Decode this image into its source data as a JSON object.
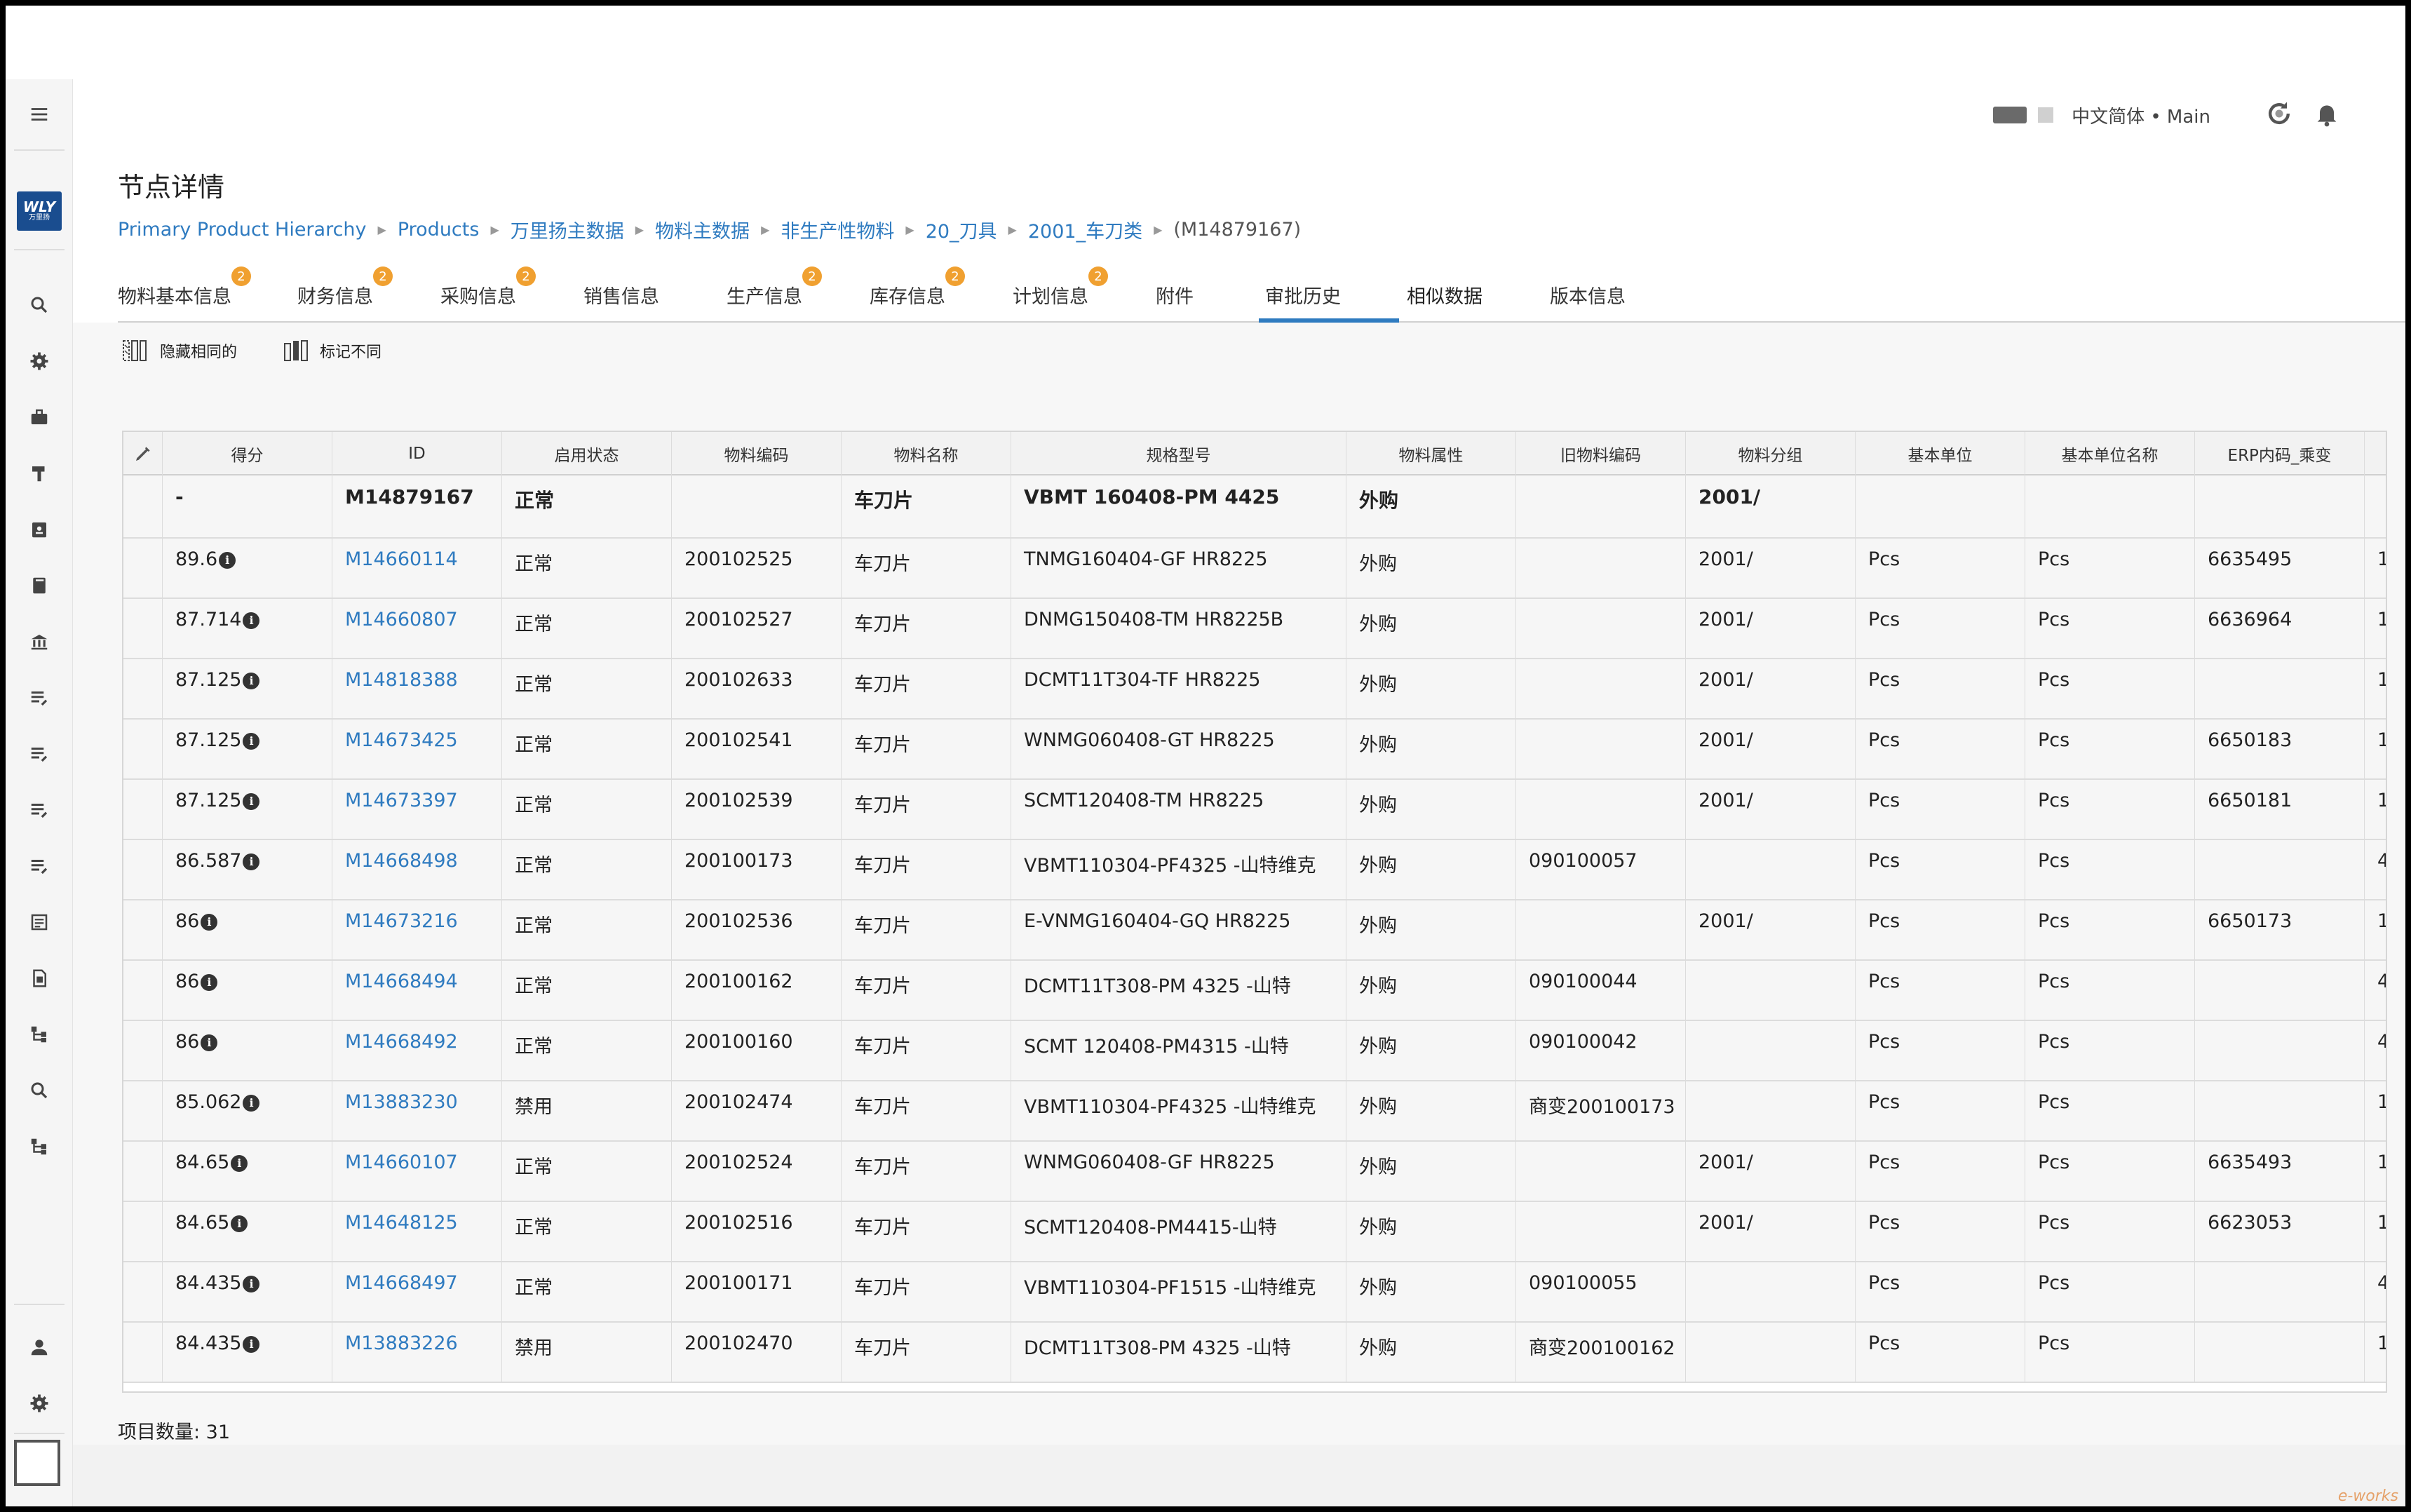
{
  "header": {
    "language": "中文简体 • Main",
    "icons": [
      "refresh-icon",
      "bell-icon"
    ]
  },
  "nav": {
    "logo_text": "WLY",
    "logo_sub": "万里扬",
    "icons": [
      "menu-icon",
      "search-icon",
      "gear-icon",
      "briefcase-icon",
      "tool-icon",
      "clipboard-icon",
      "book-icon",
      "bank-icon",
      "list-edit-icon",
      "list-edit-icon",
      "list-edit-icon",
      "list-edit-icon",
      "document-icon",
      "file-icon",
      "hierarchy-icon",
      "search-icon",
      "hierarchy-icon",
      "user-icon",
      "gear-icon"
    ]
  },
  "page": {
    "title": "节点详情",
    "breadcrumb": [
      "Primary Product Hierarchy",
      "Products",
      "万里扬主数据",
      "物料主数据",
      "非生产性物料",
      "20_刀具",
      "2001_车刀类"
    ],
    "current": "(M14879167)"
  },
  "tabs": [
    {
      "label": "物料基本信息",
      "badge": "2"
    },
    {
      "label": "财务信息",
      "badge": "2"
    },
    {
      "label": "采购信息",
      "badge": "2"
    },
    {
      "label": "销售信息",
      "badge": ""
    },
    {
      "label": "生产信息",
      "badge": "2"
    },
    {
      "label": "库存信息",
      "badge": "2"
    },
    {
      "label": "计划信息",
      "badge": "2"
    },
    {
      "label": "附件",
      "badge": ""
    },
    {
      "label": "审批历史",
      "badge": ""
    },
    {
      "label": "相似数据",
      "badge": "",
      "active": true
    },
    {
      "label": "版本信息",
      "badge": ""
    }
  ],
  "toolbar": {
    "hide_same": "隐藏相同的",
    "mark_diff": "标记不同"
  },
  "table": {
    "columns": [
      "得分",
      "ID",
      "启用状态",
      "物料编码",
      "物料名称",
      "规格型号",
      "物料属性",
      "旧物料编码",
      "物料分组",
      "基本单位",
      "基本单位名称",
      "ERP内码_乘变"
    ],
    "reference": [
      "-",
      "M14879167",
      "正常",
      "",
      "车刀片",
      "VBMT 160408-PM 4425",
      "外购",
      "",
      "2001/",
      "",
      "",
      ""
    ],
    "rows": [
      [
        "89.6",
        "M14660114",
        "正常",
        "200102525",
        "车刀片",
        "TNMG160404-GF HR8225",
        "外购",
        "",
        "2001/",
        "Pcs",
        "Pcs",
        "6635495",
        "1"
      ],
      [
        "87.714",
        "M14660807",
        "正常",
        "200102527",
        "车刀片",
        "DNMG150408-TM HR8225B",
        "外购",
        "",
        "2001/",
        "Pcs",
        "Pcs",
        "6636964",
        "1"
      ],
      [
        "87.125",
        "M14818388",
        "正常",
        "200102633",
        "车刀片",
        "DCMT11T304-TF HR8225",
        "外购",
        "",
        "2001/",
        "Pcs",
        "Pcs",
        "",
        "1"
      ],
      [
        "87.125",
        "M14673425",
        "正常",
        "200102541",
        "车刀片",
        "WNMG060408-GT HR8225",
        "外购",
        "",
        "2001/",
        "Pcs",
        "Pcs",
        "6650183",
        "1"
      ],
      [
        "87.125",
        "M14673397",
        "正常",
        "200102539",
        "车刀片",
        "SCMT120408-TM HR8225",
        "外购",
        "",
        "2001/",
        "Pcs",
        "Pcs",
        "6650181",
        "1"
      ],
      [
        "86.587",
        "M14668498",
        "正常",
        "200100173",
        "车刀片",
        "VBMT110304-PF4325 -山特维克",
        "外购",
        "090100057",
        "",
        "Pcs",
        "Pcs",
        "",
        "4"
      ],
      [
        "86",
        "M14673216",
        "正常",
        "200102536",
        "车刀片",
        "E-VNMG160404-GQ HR8225",
        "外购",
        "",
        "2001/",
        "Pcs",
        "Pcs",
        "6650173",
        "1"
      ],
      [
        "86",
        "M14668494",
        "正常",
        "200100162",
        "车刀片",
        "DCMT11T308-PM 4325 -山特",
        "外购",
        "090100044",
        "",
        "Pcs",
        "Pcs",
        "",
        "4"
      ],
      [
        "86",
        "M14668492",
        "正常",
        "200100160",
        "车刀片",
        "SCMT 120408-PM4315 -山特",
        "外购",
        "090100042",
        "",
        "Pcs",
        "Pcs",
        "",
        "4"
      ],
      [
        "85.062",
        "M13883230",
        "禁用",
        "200102474",
        "车刀片",
        "VBMT110304-PF4325 -山特维克",
        "外购",
        "商变200100173",
        "",
        "Pcs",
        "Pcs",
        "",
        "1"
      ],
      [
        "84.65",
        "M14660107",
        "正常",
        "200102524",
        "车刀片",
        "WNMG060408-GF HR8225",
        "外购",
        "",
        "2001/",
        "Pcs",
        "Pcs",
        "6635493",
        "1"
      ],
      [
        "84.65",
        "M14648125",
        "正常",
        "200102516",
        "车刀片",
        "SCMT120408-PM4415-山特",
        "外购",
        "",
        "2001/",
        "Pcs",
        "Pcs",
        "6623053",
        "1"
      ],
      [
        "84.435",
        "M14668497",
        "正常",
        "200100171",
        "车刀片",
        "VBMT110304-PF1515 -山特维克",
        "外购",
        "090100055",
        "",
        "Pcs",
        "Pcs",
        "",
        "4"
      ],
      [
        "84.435",
        "M13883226",
        "禁用",
        "200102470",
        "车刀片",
        "DCMT11T308-PM 4325 -山特",
        "外购",
        "商变200100162",
        "",
        "Pcs",
        "Pcs",
        "",
        "1"
      ]
    ]
  },
  "footer": {
    "item_count": "项目数量: 31"
  },
  "watermark": "e-works"
}
